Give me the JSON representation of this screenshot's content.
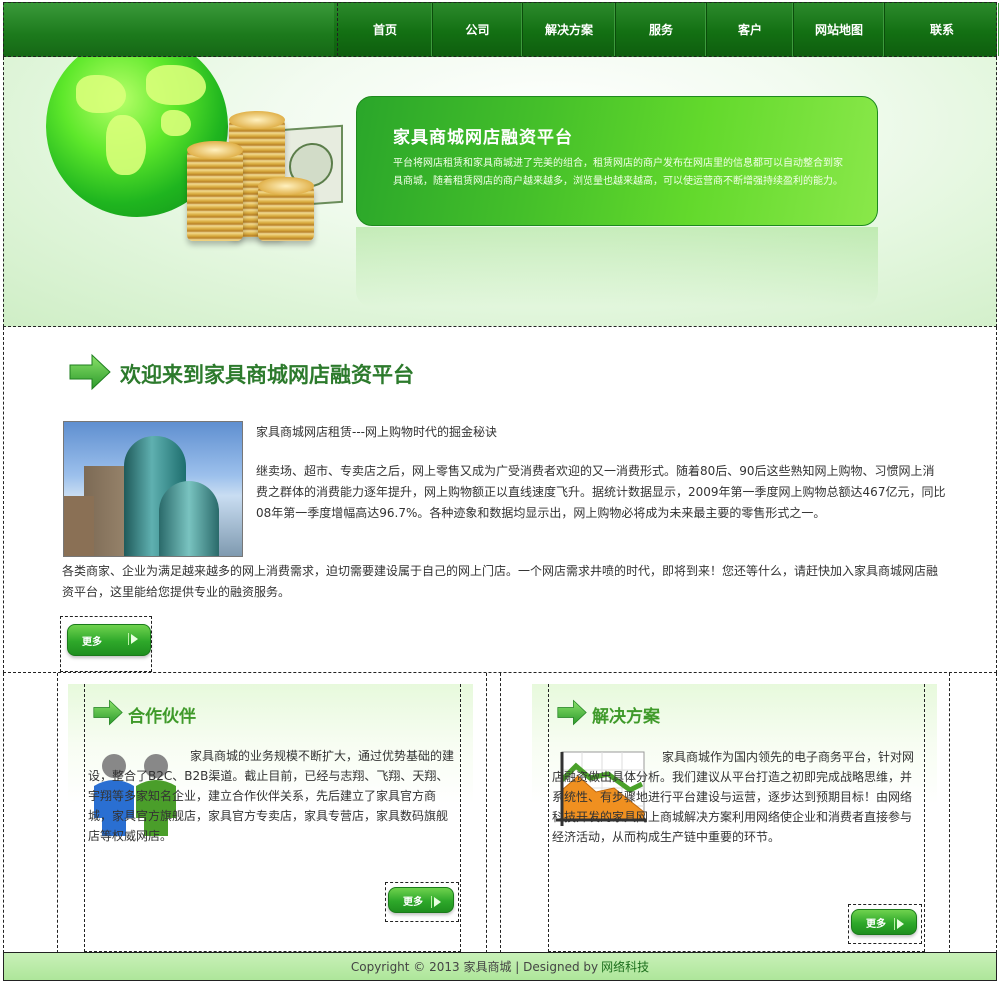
{
  "nav": {
    "items": [
      {
        "label": "首页"
      },
      {
        "label": "公司"
      },
      {
        "label": "解决方案"
      },
      {
        "label": "服务"
      },
      {
        "label": "客户"
      },
      {
        "label": "网站地图"
      },
      {
        "label": "联系"
      }
    ]
  },
  "banner": {
    "title": "家具商城网店融资平台",
    "text": "平台将网店租赁和家具商城进了完美的组合，租赁网店的商户发布在网店里的信息都可以自动整合到家具商城，随着租赁网店的商户越来越多，浏览量也越来越高，可以使运营商不断增强持续盈利的能力。"
  },
  "welcome": {
    "heading": "欢迎来到家具商城网店融资平台",
    "subtitle": "家具商城网店租赁---网上购物时代的掘金秘诀",
    "paragraph1": "继卖场、超市、专卖店之后，网上零售又成为广受消费者欢迎的又一消费形式。随着80后、90后这些熟知网上购物、习惯网上消费之群体的消费能力逐年提升，网上购物额正以直线速度飞升。据统计数据显示，2009年第一季度网上购物总额达467亿元，同比08年第一季度增幅高达96.7%。各种迹象和数据均显示出，网上购物必将成为未来最主要的零售形式之一。",
    "paragraph2": "各类商家、企业为满足越来越多的网上消费需求，迫切需要建设属于自己的网上门店。一个网店需求井喷的时代，即将到来！您还等什么，请赶快加入家具商城网店融资平台，这里能给您提供专业的融资服务。",
    "more_label": "更多"
  },
  "partners": {
    "heading": "合作伙伴",
    "text": "家具商城的业务规模不断扩大，通过优势基础的建设，整合了B2C、B2B渠道。截止目前，已经与志翔、飞翔、天翔、宇翔等多家知名企业，建立合作伙伴关系，先后建立了家具官方商城，家具官方旗舰店，家具官方专卖店，家具专营店，家具数码旗舰店等权威网店。",
    "more_label": "更多"
  },
  "solutions": {
    "heading": "解决方案",
    "text": "家具商城作为国内领先的电子商务平台，针对网店融资做出具体分析。我们建议从平台打造之初即完成战略思维，并系统性、有步骤地进行平台建设与运营，逐步达到预期目标！由网络科技开发的家具网上商城解决方案利用网络使企业和消费者直接参与经济活动，从而构成生产链中重要的环节。",
    "more_label": "更多"
  },
  "footer": {
    "copyright": "Copyright © 2013 家具商城 | Designed by",
    "link": "网络科技"
  },
  "colors": {
    "brand_green": "#137013",
    "accent_green": "#3f9a2a",
    "footer_bg": "#c8f0b8"
  }
}
